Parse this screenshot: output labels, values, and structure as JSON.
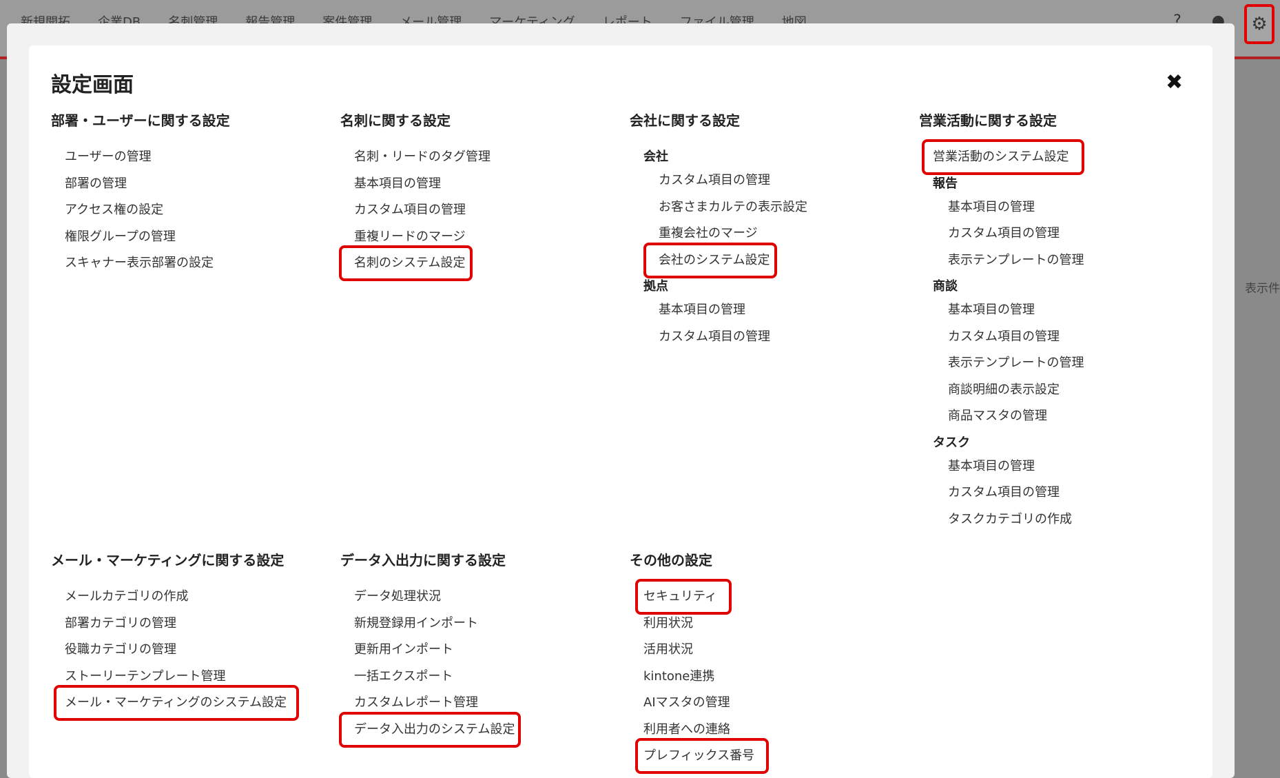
{
  "topbar": {
    "nav": [
      "新規開拓",
      "企業DB",
      "名刺管理",
      "報告管理",
      "案件管理",
      "メール管理",
      "マーケティング",
      "レポート",
      "ファイル管理",
      "地図"
    ],
    "gear_icon": "gear-icon",
    "bg_text": "表示件"
  },
  "modal": {
    "title": "設定画面",
    "close_icon": "close-icon",
    "sections": {
      "user": {
        "heading": "部署・ユーザーに関する設定",
        "items": [
          "ユーザーの管理",
          "部署の管理",
          "アクセス権の設定",
          "権限グループの管理",
          "スキャナー表示部署の設定"
        ]
      },
      "card": {
        "heading": "名刺に関する設定",
        "items": [
          "名刺・リードのタグ管理",
          "基本項目の管理",
          "カスタム項目の管理",
          "重複リードのマージ",
          "名刺のシステム設定"
        ]
      },
      "company": {
        "heading": "会社に関する設定",
        "group1": "会社",
        "group1_items": [
          "カスタム項目の管理",
          "お客さまカルテの表示設定",
          "重複会社のマージ",
          "会社のシステム設定"
        ],
        "group2": "拠点",
        "group2_items": [
          "基本項目の管理",
          "カスタム項目の管理"
        ]
      },
      "sales": {
        "heading": "営業活動に関する設定",
        "top_item": "営業活動のシステム設定",
        "group1": "報告",
        "group1_items": [
          "基本項目の管理",
          "カスタム項目の管理",
          "表示テンプレートの管理"
        ],
        "group2": "商談",
        "group2_items": [
          "基本項目の管理",
          "カスタム項目の管理",
          "表示テンプレートの管理",
          "商談明細の表示設定",
          "商品マスタの管理"
        ],
        "group3": "タスク",
        "group3_items": [
          "基本項目の管理",
          "カスタム項目の管理",
          "タスクカテゴリの作成"
        ]
      },
      "mail": {
        "heading": "メール・マーケティングに関する設定",
        "items": [
          "メールカテゴリの作成",
          "部署カテゴリの管理",
          "役職カテゴリの管理",
          "ストーリーテンプレート管理",
          "メール・マーケティングのシステム設定"
        ]
      },
      "data": {
        "heading": "データ入出力に関する設定",
        "items": [
          "データ処理状況",
          "新規登録用インポート",
          "更新用インポート",
          "一括エクスポート",
          "カスタムレポート管理",
          "データ入出力のシステム設定"
        ]
      },
      "other": {
        "heading": "その他の設定",
        "items": [
          "セキュリティ",
          "利用状況",
          "活用状況",
          "kintone連携",
          "AIマスタの管理",
          "利用者への連絡",
          "プレフィックス番号"
        ]
      }
    }
  },
  "colors": {
    "highlight": "#e00000",
    "overlay": "#8a8a8a"
  }
}
